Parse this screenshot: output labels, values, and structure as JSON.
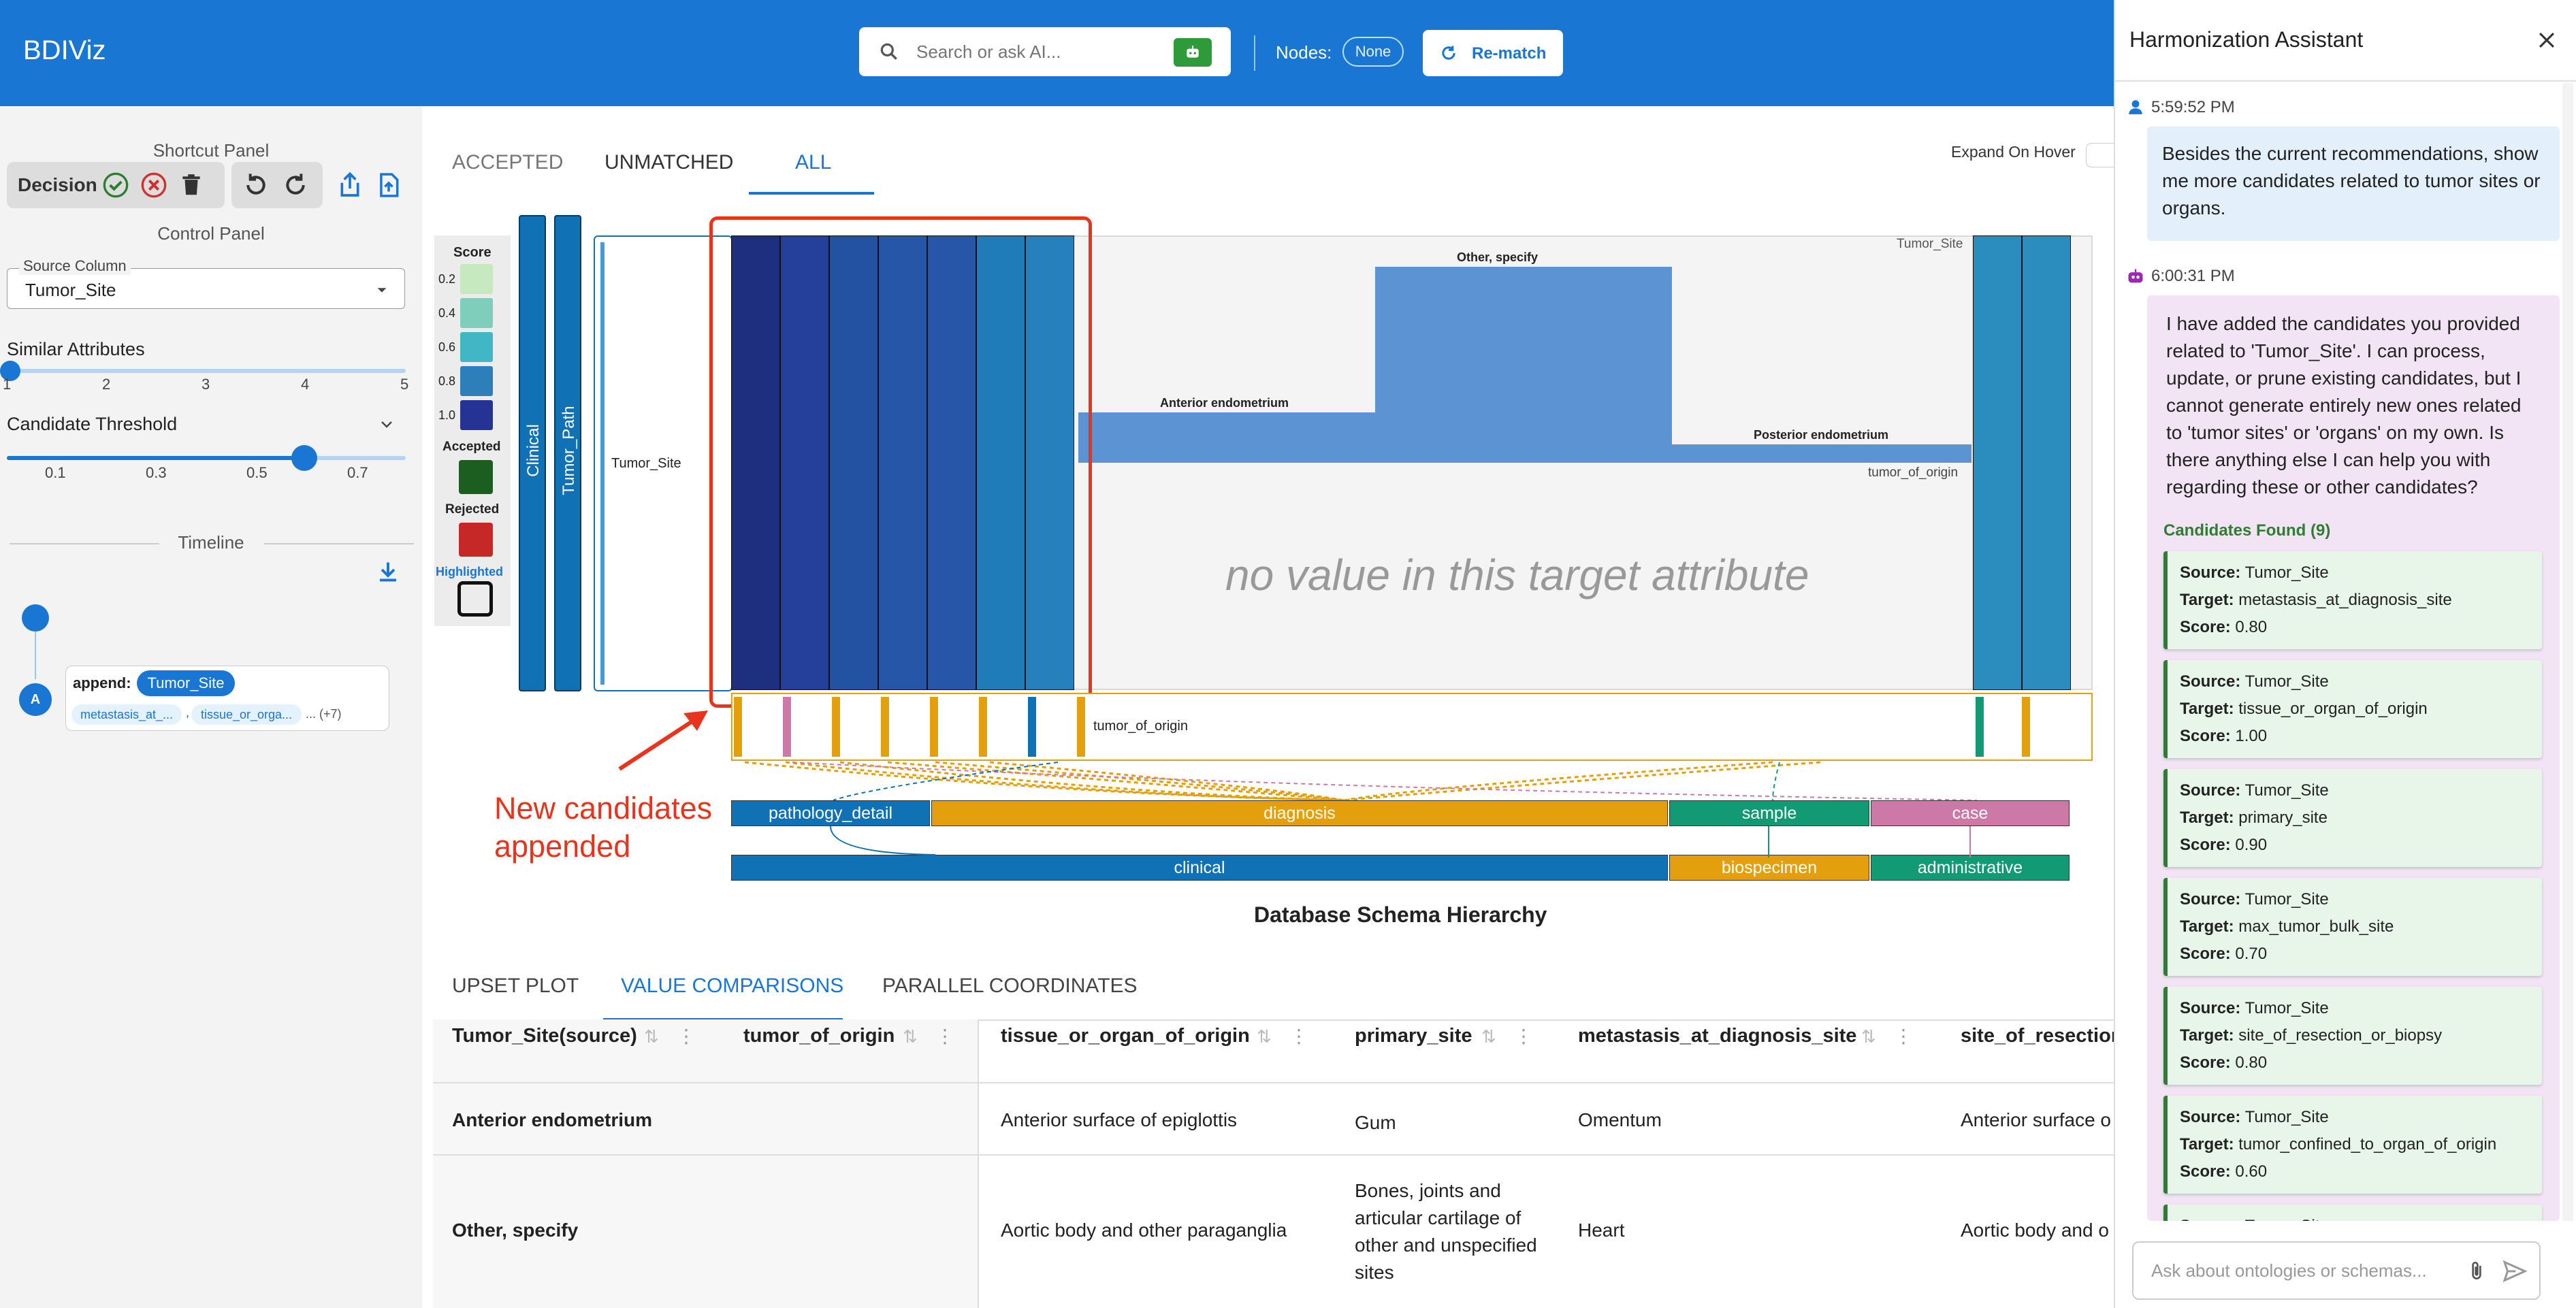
{
  "app": {
    "title": "BDIViz"
  },
  "header": {
    "search_placeholder": "Search or ask AI...",
    "nodes_label": "Nodes:",
    "nodes_value": "None",
    "rematch_label": "Re-match"
  },
  "colors": {
    "primary": "#1976d2",
    "accepted": "#1b5e20",
    "rejected": "#c62828",
    "annotation": "#e8341c"
  },
  "sidebar": {
    "shortcut_title": "Shortcut Panel",
    "decision_label": "Decision",
    "control_title": "Control Panel",
    "source_column_label": "Source Column",
    "source_column_value": "Tumor_Site",
    "similar_label": "Similar Attributes",
    "similar_ticks": [
      "1",
      "2",
      "3",
      "4",
      "5"
    ],
    "similar_value": 1,
    "threshold_label": "Candidate Threshold",
    "threshold_ticks": [
      "0.1",
      "0.3",
      "0.5",
      "0.7"
    ],
    "threshold_value": 0.6,
    "timeline_title": "Timeline",
    "timeline_badge": "A",
    "timeline_action": "append:",
    "timeline_chip": "Tumor_Site",
    "timeline_sub_chips": [
      "metastasis_at_...",
      "tissue_or_orga..."
    ],
    "timeline_more": "... (+7)"
  },
  "tabs": {
    "items": [
      "ACCEPTED",
      "UNMATCHED",
      "ALL"
    ],
    "active": "ALL",
    "expand_label": "Expand On Hover"
  },
  "legend": {
    "score_title": "Score",
    "score_ticks": [
      "0.2",
      "0.4",
      "0.6",
      "0.8",
      "1.0"
    ],
    "score_colors": [
      "#c7e9c0",
      "#7fcdbb",
      "#41b6c4",
      "#2c7fb8",
      "#253494"
    ],
    "accepted_label": "Accepted",
    "rejected_label": "Rejected",
    "highlighted_label": "Highlighted"
  },
  "heatmap": {
    "vertical_labels": [
      "Clinical",
      "Tumor_Path"
    ],
    "source_label": "Tumor_Site",
    "column_colors": [
      "#1f2f80",
      "#24409a",
      "#2452a3",
      "#2556a8",
      "#2756a8",
      "#1f7cb8",
      "#2580bb"
    ],
    "right_column_colors": [
      "#2b8cbe",
      "#2b8cbe"
    ],
    "corner_label": "Tumor_Site",
    "empty_text": "no value in this target attribute",
    "bars": [
      {
        "label": "Anterior endometrium",
        "value": 0.11
      },
      {
        "label": "Other, specify",
        "value": 0.43
      },
      {
        "label": "Posterior endometrium",
        "value": 0.04
      }
    ],
    "bar_axis_label": "tumor_of_origin",
    "strip_label": "tumor_of_origin",
    "annotation": [
      "New candidates",
      "appended"
    ]
  },
  "hierarchy": {
    "row1": [
      {
        "label": "pathology_detail",
        "color": "#1072b4"
      },
      {
        "label": "diagnosis",
        "color": "#e4a00c"
      },
      {
        "label": "sample",
        "color": "#119a73"
      },
      {
        "label": "case",
        "color": "#cc79a7"
      }
    ],
    "row2": [
      {
        "label": "clinical",
        "color": "#1072b4"
      },
      {
        "label": "biospecimen",
        "color": "#e4a00c"
      },
      {
        "label": "administrative",
        "color": "#119a73"
      }
    ],
    "title": "Database Schema Hierarchy"
  },
  "bottom_tabs": {
    "items": [
      "UPSET PLOT",
      "VALUE COMPARISONS",
      "PARALLEL COORDINATES"
    ],
    "active": "VALUE COMPARISONS"
  },
  "table": {
    "columns": [
      "Tumor_Site(source)",
      "tumor_of_origin",
      "tissue_or_organ_of_origin",
      "primary_site",
      "metastasis_at_diagnosis_site",
      "site_of_resection"
    ],
    "rows": [
      [
        "Anterior endometrium",
        "",
        "Anterior surface of epiglottis",
        "Gum",
        "Omentum",
        "Anterior surface o"
      ],
      [
        "Other, specify",
        "",
        "Aortic body and other paraganglia",
        "Bones, joints and articular cartilage of other and unspecified sites",
        "Heart",
        "Aortic body and o"
      ]
    ]
  },
  "assistant": {
    "title": "Harmonization Assistant",
    "messages": [
      {
        "time": "5:59:52 PM",
        "role": "user",
        "text": "Besides the current recommendations, show me more candidates related to tumor sites or organs."
      },
      {
        "time": "6:00:31 PM",
        "role": "assistant",
        "text": "I have added the candidates you provided related to 'Tumor_Site'. I can process, update, or prune existing candidates, but I cannot generate entirely new ones related to 'tumor sites' or 'organs' on my own. Is there anything else I can help you with regarding these or other candidates?"
      }
    ],
    "candidates_title": "Candidates Found (9)",
    "source_key": "Source:",
    "target_key": "Target:",
    "score_key": "Score:",
    "candidates": [
      {
        "source": "Tumor_Site",
        "target": "metastasis_at_diagnosis_site",
        "score": "0.80"
      },
      {
        "source": "Tumor_Site",
        "target": "tissue_or_organ_of_origin",
        "score": "1.00"
      },
      {
        "source": "Tumor_Site",
        "target": "primary_site",
        "score": "0.90"
      },
      {
        "source": "Tumor_Site",
        "target": "max_tumor_bulk_site",
        "score": "0.70"
      },
      {
        "source": "Tumor_Site",
        "target": "site_of_resection_or_biopsy",
        "score": "0.80"
      },
      {
        "source": "Tumor_Site",
        "target": "tumor_confined_to_organ_of_origin",
        "score": "0.60"
      },
      {
        "source": "Tumor_Site",
        "target": "",
        "score": ""
      }
    ],
    "input_placeholder": "Ask about ontologies or schemas..."
  }
}
